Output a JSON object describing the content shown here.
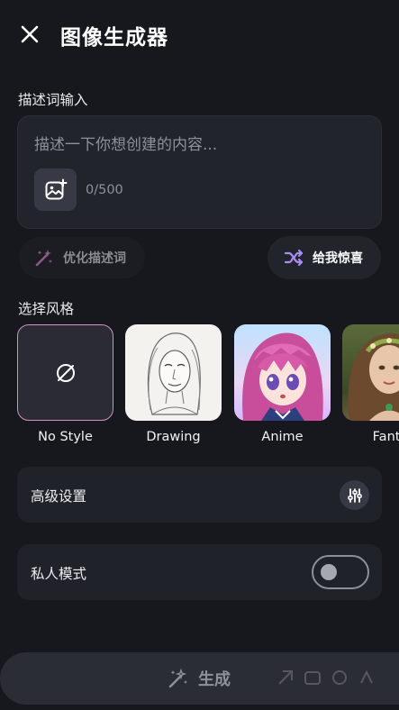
{
  "header": {
    "title": "图像生成器"
  },
  "prompt": {
    "section_label": "描述词输入",
    "placeholder": "描述一下你想创建的内容...",
    "char_count": "0/500"
  },
  "actions": {
    "optimize_label": "优化描述词",
    "surprise_label": "给我惊喜"
  },
  "styles": {
    "section_label": "选择风格",
    "items": [
      {
        "label": "No Style",
        "selected": true
      },
      {
        "label": "Drawing",
        "selected": false
      },
      {
        "label": "Anime",
        "selected": false
      },
      {
        "label": "Fanta",
        "selected": false
      }
    ]
  },
  "settings": {
    "advanced_label": "高级设置",
    "private_label": "私人模式",
    "private_enabled": false
  },
  "generate": {
    "label": "生成"
  },
  "colors": {
    "background": "#17181d",
    "card": "#22242c",
    "selected_border": "#d48fc4",
    "accent_purple": "#a98bf5",
    "muted_text": "#8e909a"
  }
}
